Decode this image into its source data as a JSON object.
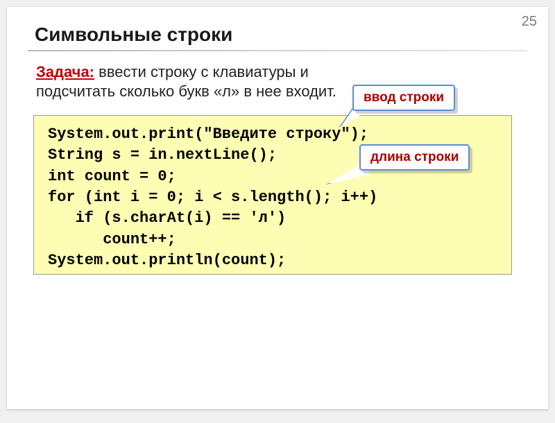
{
  "pagenum": "25",
  "title": "Символьные строки",
  "task_label": "Задача:",
  "task_text": " ввести строку с клавиатуры и подсчитать сколько букв «л» в нее входит.",
  "callout1": "ввод строки",
  "callout2": "длина строки",
  "code": "System.out.print(\"Введите строку\");\nString s = in.nextLine();\nint count = 0;\nfor (int i = 0; i < s.length(); i++)\n   if (s.charAt(i) == 'л')\n      count++;\nSystem.out.println(count);"
}
